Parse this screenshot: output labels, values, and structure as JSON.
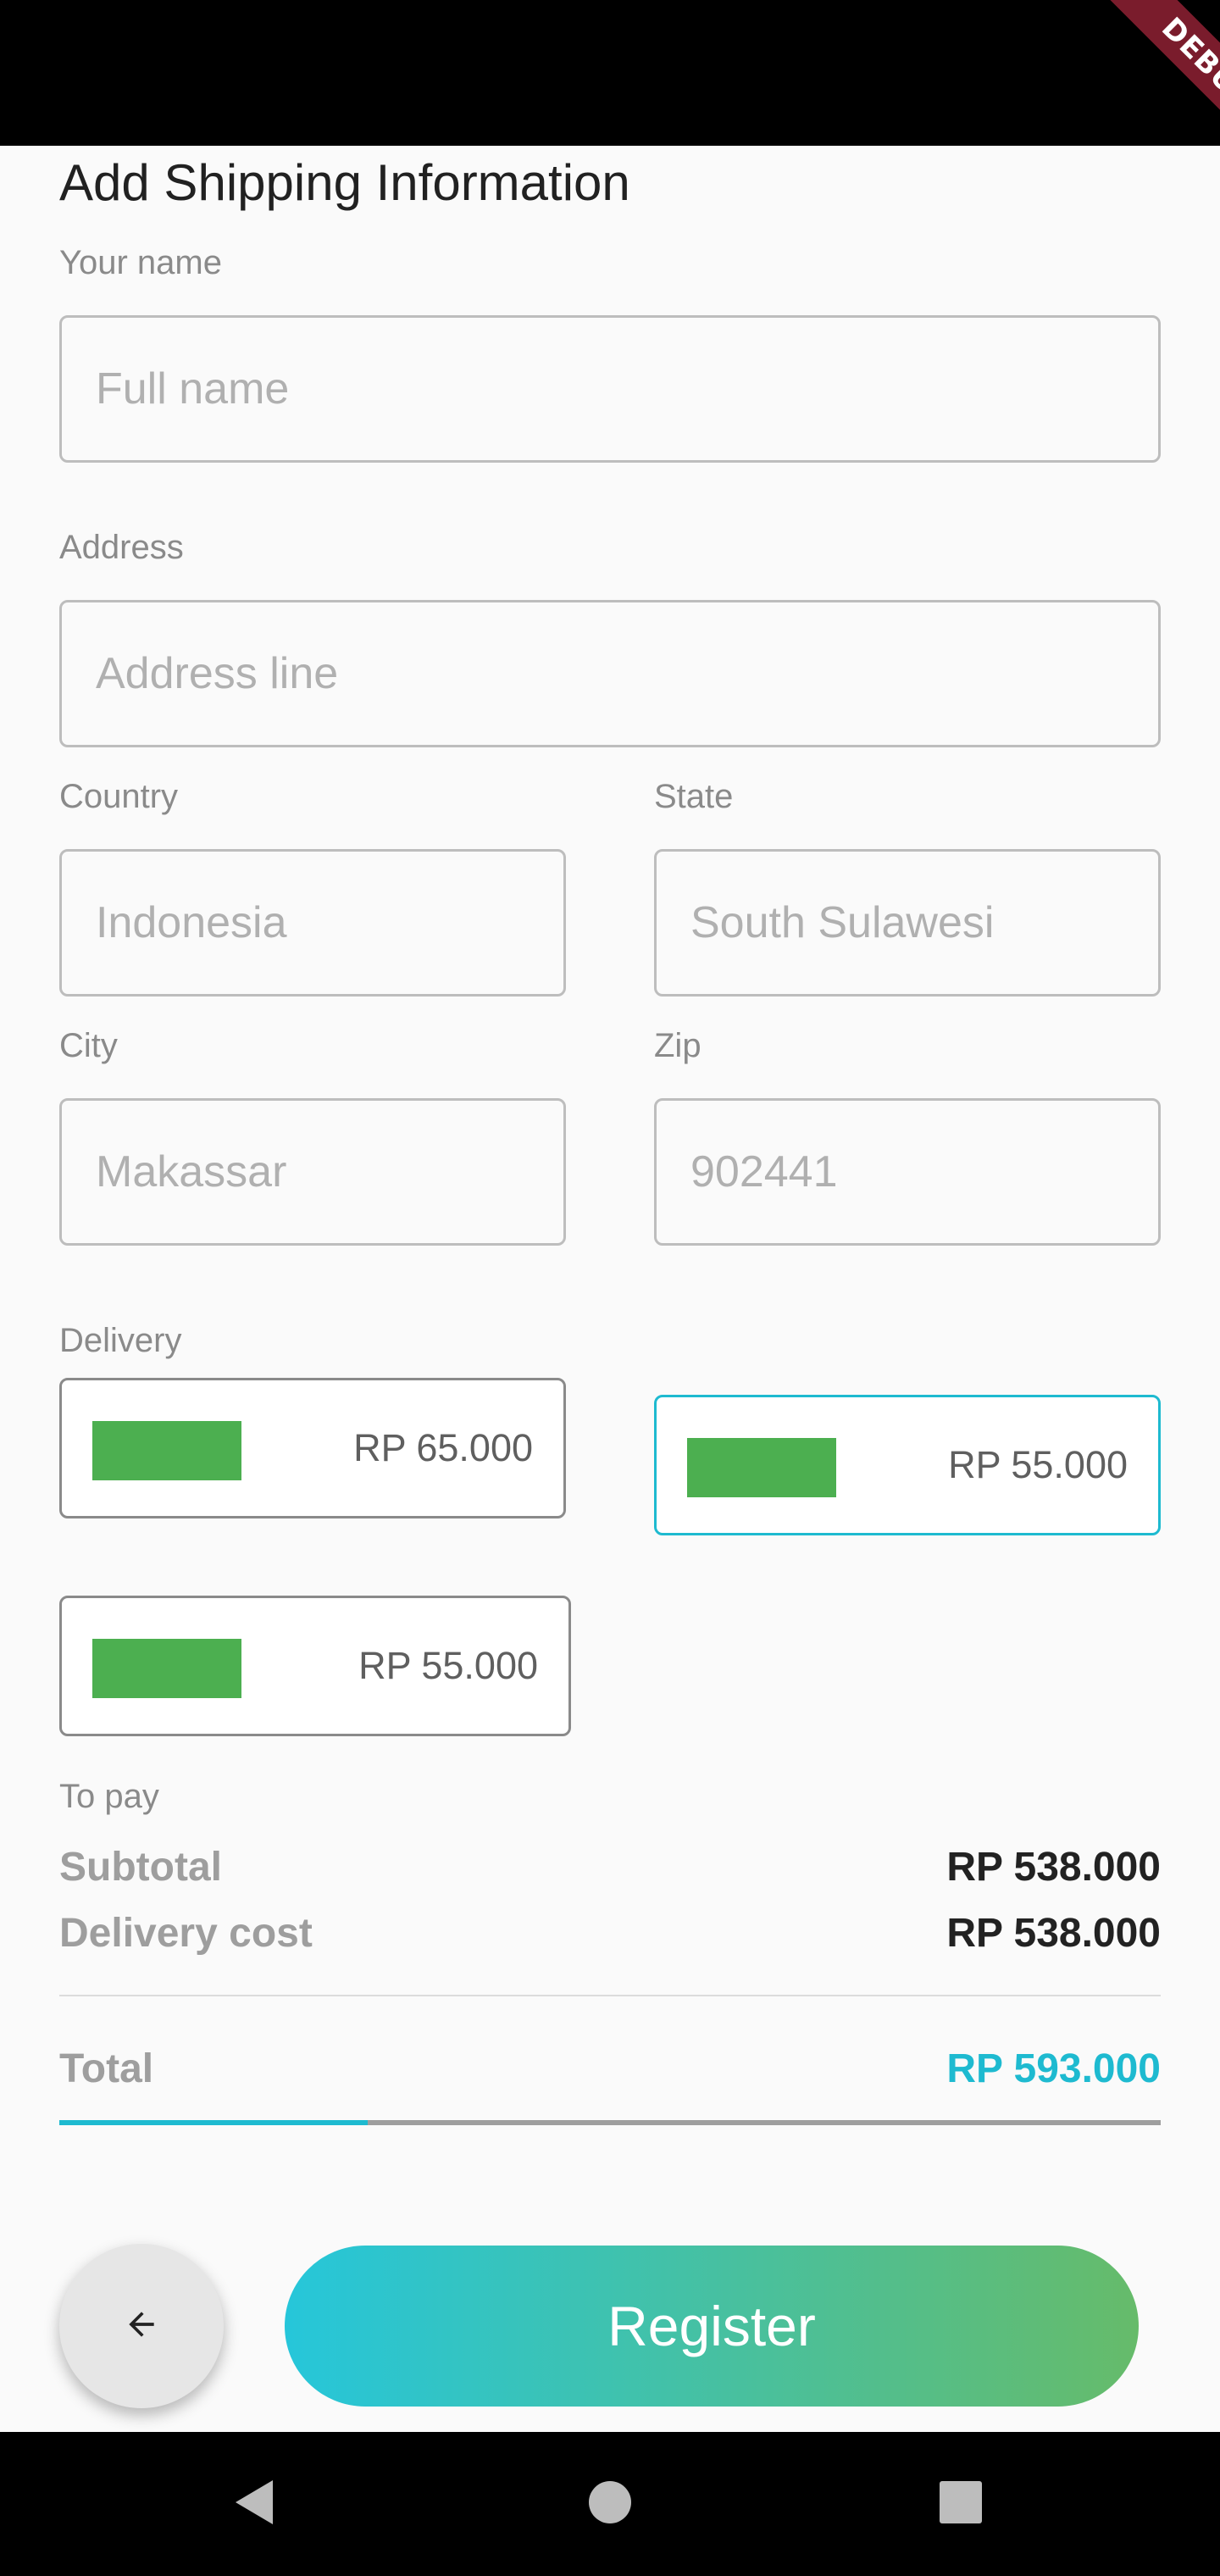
{
  "debug_banner": "DEBUG",
  "form": {
    "title": "Add Shipping Information",
    "name": {
      "label": "Your name",
      "placeholder": "Full name"
    },
    "address": {
      "label": "Address",
      "placeholder": "Address line"
    },
    "country": {
      "label": "Country",
      "placeholder": "Indonesia"
    },
    "state": {
      "label": "State",
      "placeholder": "South Sulawesi"
    },
    "city": {
      "label": "City",
      "placeholder": "Makassar"
    },
    "zip": {
      "label": "Zip",
      "placeholder": "902441"
    }
  },
  "delivery": {
    "label": "Delivery",
    "options": [
      {
        "price": "RP 65.000",
        "selected": false
      },
      {
        "price": "RP 55.000",
        "selected": true
      },
      {
        "price": "RP 55.000",
        "selected": false
      }
    ],
    "logo_color": "#4caf50",
    "selected_color": "#1ebad0"
  },
  "summary": {
    "label": "To pay",
    "subtotal_label": "Subtotal",
    "subtotal_value": "RP 538.000",
    "delivery_cost_label": "Delivery cost",
    "delivery_cost_value": "RP 538.000",
    "total_label": "Total",
    "total_value": "RP 593.000",
    "total_color": "#1ebad0"
  },
  "progress": {
    "fraction": 0.28
  },
  "actions": {
    "back_icon": "arrow-left-icon",
    "register_label": "Register"
  },
  "navigation": {
    "back_icon": "triangle-back-icon",
    "home_icon": "circle-home-icon",
    "recents_icon": "square-recents-icon"
  }
}
